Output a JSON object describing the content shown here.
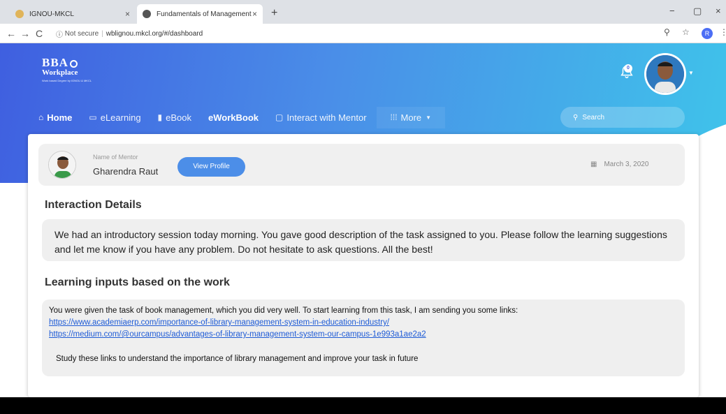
{
  "browser": {
    "tabs": [
      {
        "title": "IGNOU-MKCL",
        "active": false
      },
      {
        "title": "Fundamentals of Management",
        "active": true
      }
    ],
    "new_tab": "+",
    "close": "×",
    "minimize": "−",
    "maximize": "▢",
    "window_close": "×",
    "security": "Not secure",
    "url": "wblignou.mkcl.org/#/dashboard",
    "profile_initial": "R"
  },
  "header": {
    "logo_line1": "BBA",
    "logo_line2": "Workplace",
    "logo_tagline": "Work based Degree by IGNOU & MKCL",
    "notification_count": "0"
  },
  "menu": {
    "items": [
      {
        "label": "Home",
        "icon": "home-icon"
      },
      {
        "label": "eLearning",
        "icon": "monitor-icon"
      },
      {
        "label": "eBook",
        "icon": "book-icon"
      },
      {
        "label": "eWorkBook",
        "icon": ""
      },
      {
        "label": "Interact with Mentor",
        "icon": "chat-icon"
      },
      {
        "label": "More",
        "icon": "grid-icon"
      }
    ],
    "search_placeholder": "Search"
  },
  "mentor": {
    "label": "Name of Mentor",
    "name": "Gharendra Raut",
    "view_profile": "View Profile",
    "date": "March 3, 2020"
  },
  "interaction": {
    "heading": "Interaction Details",
    "text": "We had an introductory session today morning. You gave good description of the task assigned to you. Please follow the learning suggestions and let me know if you have any problem. Do not hesitate to ask questions. All the best!"
  },
  "learning": {
    "heading": "Learning inputs based on the work",
    "intro": "You were given the task of book management, which you did very well. To start learning from this task, I am sending you some links:",
    "link1": "https://www.academiaerp.com/importance-of-library-management-system-in-education-industry/",
    "link2": "https://medium.com/@ourcampus/advantages-of-library-management-system-our-campus-1e993a1ae2a2",
    "note": "Study these links to understand the importance of library management and improve your task in future"
  },
  "colors": {
    "hero_start": "#3f5fe0",
    "hero_end": "#3fc3ea",
    "button": "#4c8ee8",
    "link": "#1e5bd6"
  }
}
